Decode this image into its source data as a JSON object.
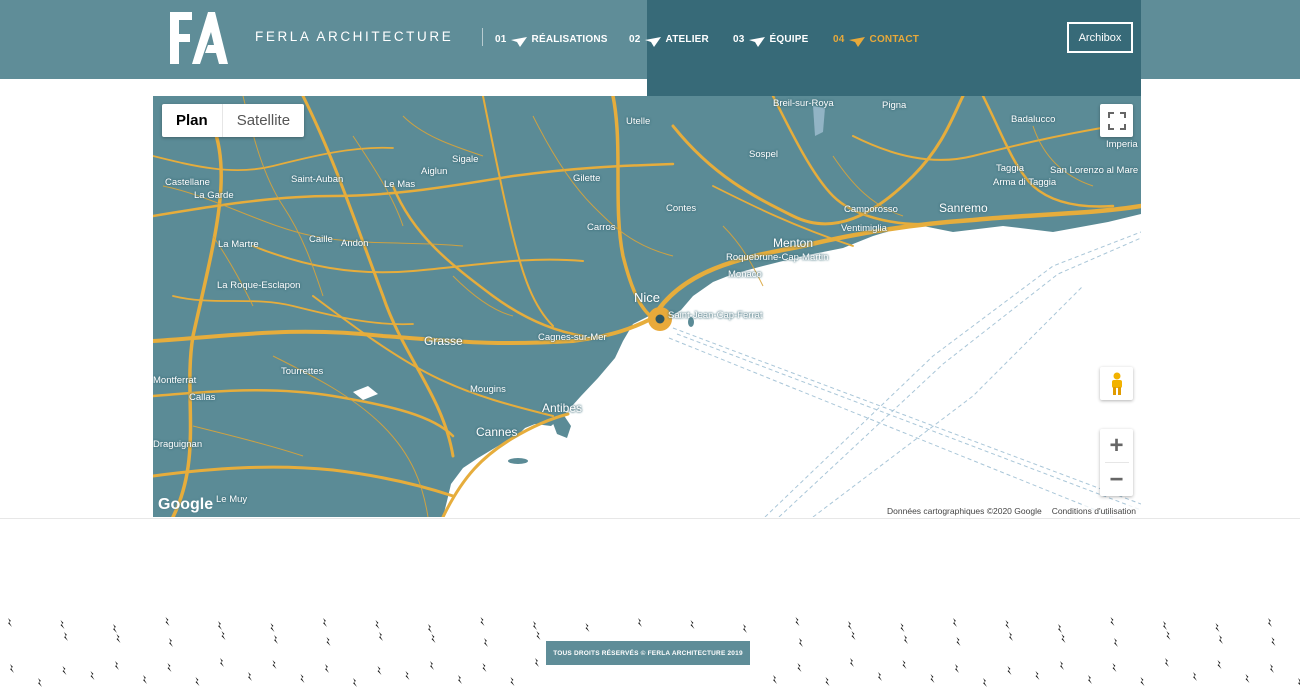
{
  "brand": {
    "name": "FERLA ARCHITECTURE",
    "logo_letters": "FA"
  },
  "nav": {
    "items": [
      {
        "num": "01",
        "label": "RÉALISATIONS"
      },
      {
        "num": "02",
        "label": "ATELIER"
      },
      {
        "num": "03",
        "label": "ÉQUIPE"
      },
      {
        "num": "04",
        "label": "CONTACT",
        "active": true
      }
    ],
    "archibox_label": "Archibox"
  },
  "map": {
    "type_plan": "Plan",
    "type_satellite": "Satellite",
    "google_logo": "Google",
    "attribution": "Données cartographiques ©2020 Google",
    "terms": "Conditions d'utilisation",
    "labels": {
      "nice": "Nice",
      "cannes": "Cannes",
      "antibes": "Antibes",
      "grasse": "Grasse",
      "menton": "Menton",
      "monaco": "Monaco",
      "sanremo": "Sanremo",
      "cagnes": "Cagnes-sur-Mer",
      "stjean": "Saint-Jean-Cap-Ferrat",
      "roquebrune": "Roquebrune-Cap-Martin",
      "mougins": "Mougins",
      "castellane": "Castellane",
      "lagarde": "La Garde",
      "saintauban": "Saint-Auban",
      "lemas": "Le Mas",
      "sigale": "Sigale",
      "aiglun": "Aiglun",
      "gilette": "Gilette",
      "utelle": "Utelle",
      "sospel": "Sospel",
      "breil": "Breil-sur-Roya",
      "pigna": "Pigna",
      "badalucco": "Badalucco",
      "imperia": "Imperia",
      "taggia": "Taggia",
      "arma": "Arma di Taggia",
      "sanlorenzo": "San Lorenzo al Mare",
      "camporosso": "Camporosso",
      "ventimiglia": "Ventimiglia",
      "contes": "Contes",
      "carros": "Carros",
      "lamartre": "La Martre",
      "caille": "Caille",
      "andon": "Andon",
      "laroque": "La Roque-Esclapon",
      "tourrettes": "Tourrettes",
      "callas": "Callas",
      "lemuy": "Le Muy",
      "montferrat": "Montferrat",
      "draguignan": "Draguignan"
    }
  },
  "footer": {
    "copyright": "TOUS DROITS RÉSERVÉS © FERLA ARCHITECTURE 2019"
  },
  "colors": {
    "header": "#5f8d98",
    "header_dark": "#376a78",
    "accent": "#e8a93a",
    "land": "#5b8b96",
    "roads": "#e6ad3c"
  }
}
